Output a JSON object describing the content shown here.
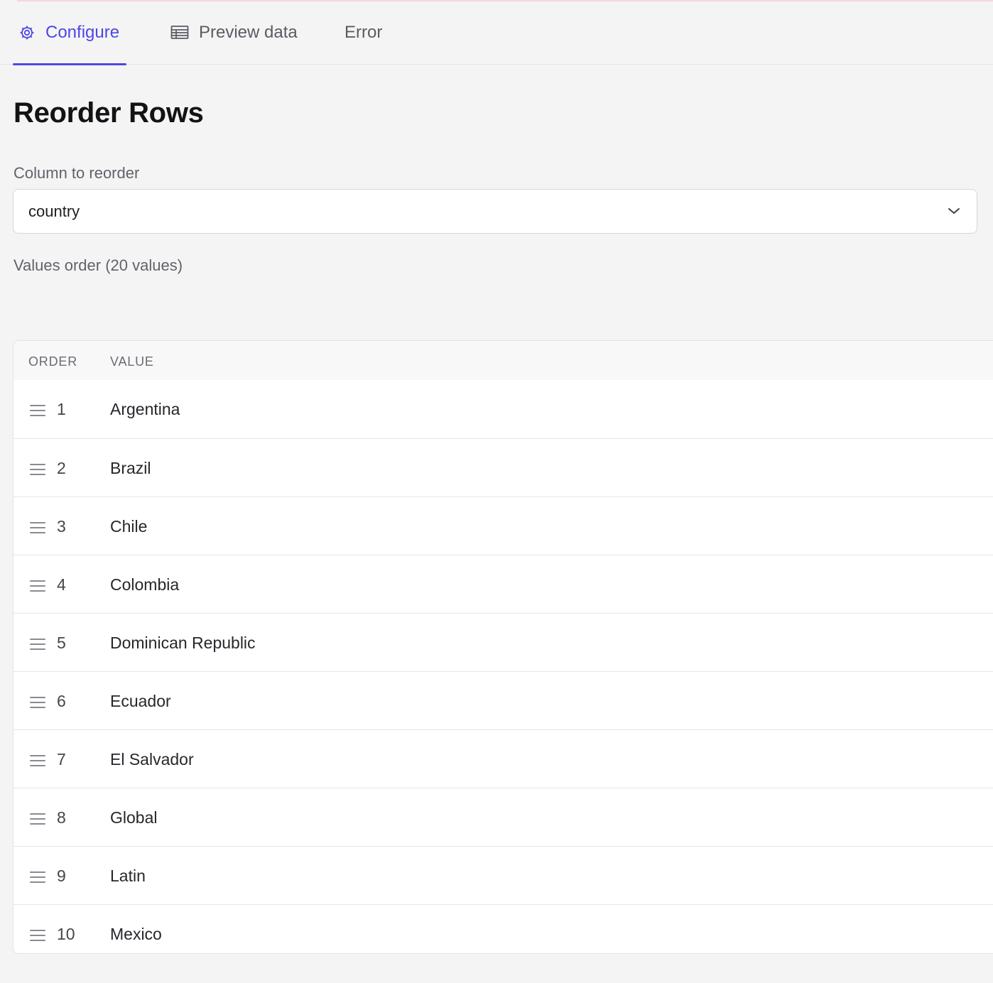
{
  "tabs": [
    {
      "label": "Configure",
      "icon": "gear-icon",
      "active": true
    },
    {
      "label": "Preview data",
      "icon": "table-icon",
      "active": false
    },
    {
      "label": "Error",
      "icon": "",
      "active": false
    }
  ],
  "page": {
    "title": "Reorder Rows",
    "column_label": "Column to reorder",
    "column_value": "country",
    "values_label": "Values order (20 values)"
  },
  "table": {
    "headers": {
      "order": "ORDER",
      "value": "VALUE"
    },
    "rows": [
      {
        "order": "1",
        "value": "Argentina"
      },
      {
        "order": "2",
        "value": "Brazil"
      },
      {
        "order": "3",
        "value": "Chile"
      },
      {
        "order": "4",
        "value": "Colombia"
      },
      {
        "order": "5",
        "value": "Dominican Republic"
      },
      {
        "order": "6",
        "value": "Ecuador"
      },
      {
        "order": "7",
        "value": "El Salvador"
      },
      {
        "order": "8",
        "value": "Global"
      },
      {
        "order": "9",
        "value": "Latin"
      },
      {
        "order": "10",
        "value": "Mexico"
      }
    ]
  },
  "colors": {
    "accent": "#4f46e5"
  }
}
